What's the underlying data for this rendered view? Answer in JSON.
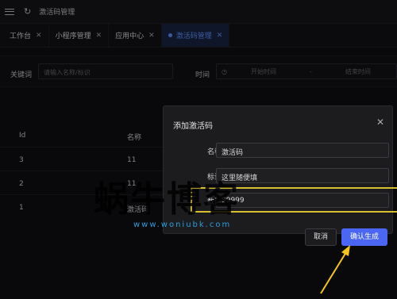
{
  "header": {
    "breadcrumb": "激活码管理"
  },
  "tabs": [
    {
      "label": "工作台"
    },
    {
      "label": "小程序管理"
    },
    {
      "label": "应用中心"
    },
    {
      "label": "激活码管理",
      "active": true
    }
  ],
  "filters": {
    "keyword_label": "关键词",
    "keyword_placeholder": "请输入名称/标识",
    "time_label": "时间",
    "start_placeholder": "开始时间",
    "separator": "-",
    "end_placeholder": "结束时间"
  },
  "table": {
    "headers": [
      "Id",
      "名称"
    ],
    "rows": [
      {
        "id": "3",
        "name": "11"
      },
      {
        "id": "2",
        "name": "11"
      },
      {
        "id": "1",
        "name": "激活码"
      }
    ]
  },
  "modal": {
    "title": "添加激活码",
    "fields": [
      {
        "label": "名称:",
        "value": "激活码"
      },
      {
        "label": "标识:",
        "value": "这里随便填"
      },
      {
        "label": "数量:",
        "value": "99999"
      }
    ],
    "cancel_label": "取消",
    "confirm_label": "确认生成"
  },
  "watermark": {
    "text": "蜗牛博客",
    "url": "www.woniubk.com"
  },
  "colors": {
    "accent": "#4a66f2",
    "highlight": "#d6c02c",
    "annotation_arrow": "#f5c518"
  }
}
